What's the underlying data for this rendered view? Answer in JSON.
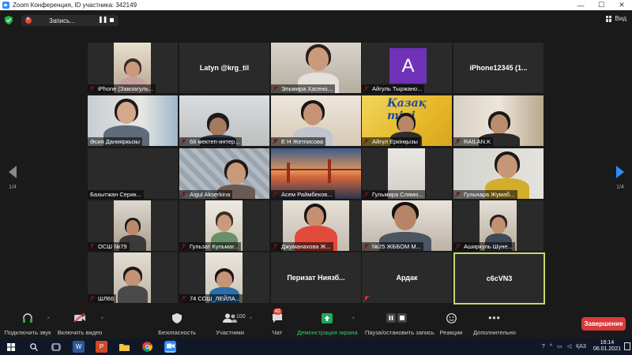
{
  "titlebar": {
    "title": "Zoom Конференция, ID участника: 342149"
  },
  "topbar": {
    "record_label": "Запись...",
    "view_label": "Вид"
  },
  "pagination": {
    "left": "1/4",
    "right": "1/4"
  },
  "tiles": {
    "t1": "iPhone (Замзагуль...",
    "t2": "Latyn @krg_til",
    "t3": "Эльмира Хасено...",
    "t4": "Айгуль Тыржано...",
    "t4_avatar": "A",
    "t5": "iPhone12345 (1...",
    "t6": "Әсия Данияркызы",
    "t7": "68 мектеп-интер...",
    "t8": "Е Н Жетписова",
    "t9": "Айгүл Еркінқызы",
    "t9_banner": "Қазақ тілі",
    "t10": "RAILAN.K",
    "t11": "Бахытжан Серик...",
    "t12": "Aigul Akserkina",
    "t13": "Асем Раймбеков...",
    "t14": "Гульмира Слямо...",
    "t15": "Гульнара Жумаб...",
    "t16": "ОСШ №79",
    "t17": "Гульзат Кульмаг...",
    "t18": "Джуманахова Ж...",
    "t19": "№25 ЖББОМ М...",
    "t20": "Аширкуль Шуне...",
    "t21": "ШЛ66",
    "t22": "74 СОШ_ЛЕЙЛА...",
    "t23": "Перизат  Ниязб...",
    "t24": "Ардак",
    "t25": "c6cVN3"
  },
  "toolbar": {
    "audio": "Подключить звук",
    "video": "Включить видео",
    "security": "Безопасность",
    "participants": "Участники",
    "participants_count": "100",
    "chat": "Чат",
    "chat_badge": "42",
    "share": "Демонстрация экрана",
    "record": "Пауза/остановить запись",
    "reactions": "Реакции",
    "more": "Дополнительно",
    "end": "Завершение"
  },
  "taskbar": {
    "lang": "ҚАЗ",
    "time": "16:14",
    "date": "06.01.2021"
  },
  "colors": {
    "accent": "#2d8cff",
    "share_green": "#1fa85a",
    "end_red": "#d93a3a",
    "active_border": "#c7d66b"
  }
}
